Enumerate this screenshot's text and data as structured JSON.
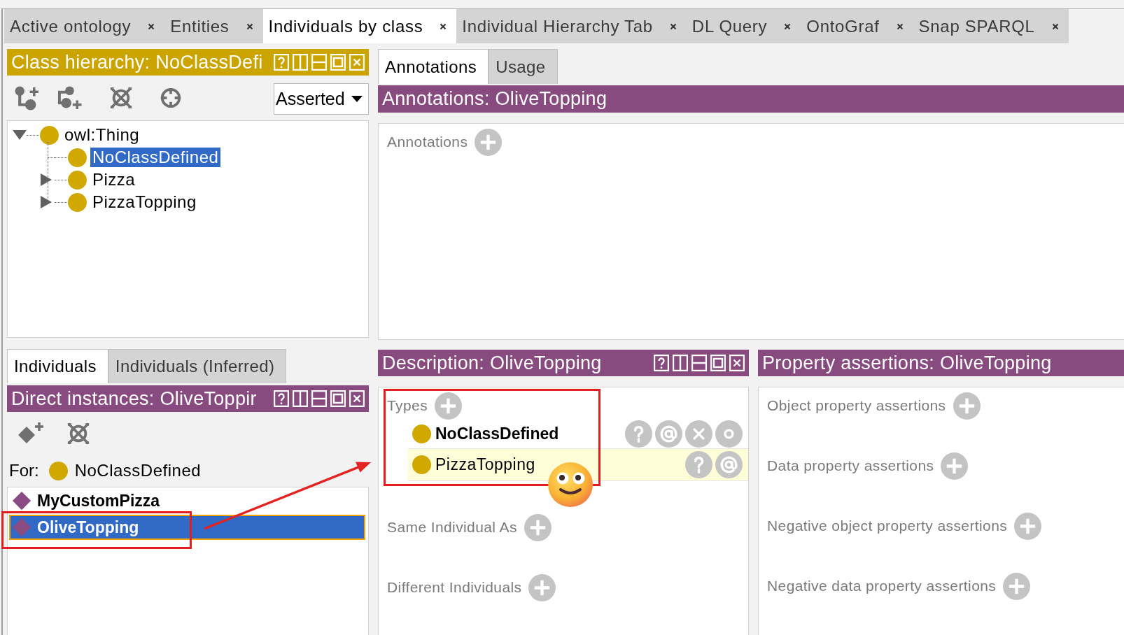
{
  "tabs": [
    {
      "label": "Active ontology",
      "selected": false
    },
    {
      "label": "Entities",
      "selected": false
    },
    {
      "label": "Individuals by class",
      "selected": true
    },
    {
      "label": "Individual Hierarchy Tab",
      "selected": false
    },
    {
      "label": "DL Query",
      "selected": false
    },
    {
      "label": "OntoGraf",
      "selected": false
    },
    {
      "label": "Snap SPARQL",
      "selected": false
    }
  ],
  "class_hierarchy": {
    "title": "Class hierarchy: NoClassDefi",
    "view_mode": "Asserted",
    "tree": [
      {
        "label": "owl:Thing",
        "kind": "expanded",
        "selected": false,
        "children": [
          {
            "label": "NoClassDefined",
            "kind": "leaf",
            "selected": true
          },
          {
            "label": "Pizza",
            "kind": "collapsed",
            "selected": false
          },
          {
            "label": "PizzaTopping",
            "kind": "collapsed",
            "selected": false
          }
        ]
      }
    ]
  },
  "individuals": {
    "tabs": [
      {
        "label": "Individuals",
        "selected": true
      },
      {
        "label": "Individuals (Inferred)",
        "selected": false
      }
    ],
    "title": "Direct instances: OliveToppir",
    "for_label": "For:",
    "for_class": "NoClassDefined",
    "items": [
      {
        "label": "MyCustomPizza",
        "selected": false
      },
      {
        "label": "OliveTopping",
        "selected": true
      }
    ]
  },
  "entity_tabs": [
    {
      "label": "Annotations",
      "selected": true
    },
    {
      "label": "Usage",
      "selected": false
    }
  ],
  "annotations": {
    "title": "Annotations: OliveTopping",
    "sections": [
      "Annotations"
    ]
  },
  "description": {
    "title": "Description: OliveTopping",
    "sections": [
      {
        "label": "Types",
        "items": [
          {
            "label": "NoClassDefined",
            "inferred": false
          },
          {
            "label": "PizzaTopping",
            "inferred": true
          }
        ]
      },
      {
        "label": "Same Individual As"
      },
      {
        "label": "Different Individuals"
      }
    ]
  },
  "property_assertions": {
    "title": "Property assertions: OliveTopping",
    "sections": [
      "Object property assertions",
      "Data property assertions",
      "Negative object property assertions",
      "Negative data property assertions"
    ]
  }
}
